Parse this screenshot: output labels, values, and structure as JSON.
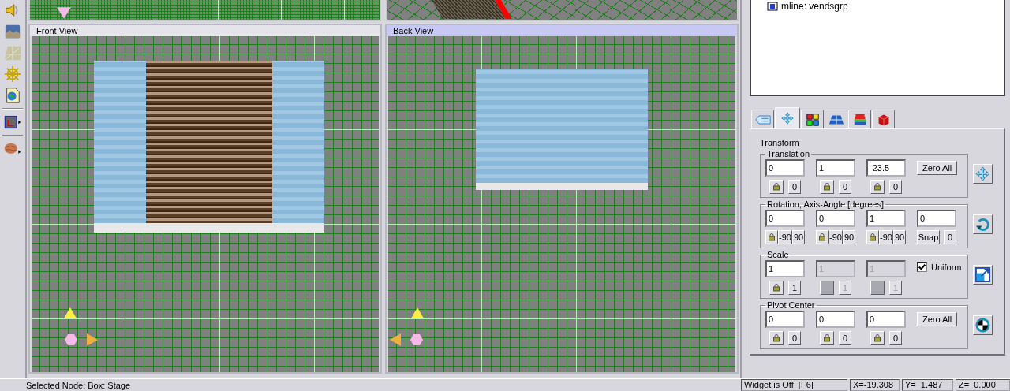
{
  "views": [
    {
      "title": "Front View",
      "selected": false
    },
    {
      "title": "Back View",
      "selected": true
    }
  ],
  "tree": {
    "items": [
      {
        "label": "mline: vendsgrp"
      }
    ]
  },
  "tabs": [
    {
      "kind": "tag",
      "selected": false
    },
    {
      "kind": "move",
      "selected": true
    },
    {
      "kind": "colors",
      "selected": false
    },
    {
      "kind": "plane",
      "selected": false
    },
    {
      "kind": "layers",
      "selected": false
    },
    {
      "kind": "cube",
      "selected": false
    }
  ],
  "transform": {
    "title": "Transform",
    "groups": [
      {
        "title": "Translation",
        "kind": "move",
        "fields": [
          {
            "value": "0",
            "disabled": false,
            "lock": true,
            "buttons": [
              "0"
            ]
          },
          {
            "value": "1",
            "disabled": false,
            "lock": true,
            "buttons": [
              "0"
            ]
          },
          {
            "value": "-23.5",
            "disabled": false,
            "lock": true,
            "buttons": [
              "0"
            ]
          }
        ],
        "extra": {
          "kind": "button",
          "label": "Zero All"
        }
      },
      {
        "title": "Rotation, Axis-Angle  [degrees]",
        "kind": "rotate",
        "fields": [
          {
            "value": "0",
            "disabled": false,
            "lock": true,
            "buttons": [
              "-90",
              "90"
            ]
          },
          {
            "value": "0",
            "disabled": false,
            "lock": true,
            "buttons": [
              "-90",
              "90"
            ]
          },
          {
            "value": "1",
            "disabled": false,
            "lock": true,
            "buttons": [
              "-90",
              "90"
            ]
          },
          {
            "value": "0",
            "disabled": false,
            "lock": false,
            "buttons": [
              "Snap",
              "0"
            ]
          }
        ]
      },
      {
        "title": "Scale",
        "kind": "scale",
        "fields": [
          {
            "value": "1",
            "disabled": false,
            "lock": true,
            "buttons": [
              "1"
            ]
          },
          {
            "value": "1",
            "disabled": true,
            "lock": true,
            "buttons": [
              "1"
            ]
          },
          {
            "value": "1",
            "disabled": true,
            "lock": true,
            "buttons": [
              "1"
            ]
          }
        ],
        "extra": {
          "kind": "checkbox",
          "label": "Uniform",
          "checked": true
        }
      },
      {
        "title": "Pivot Center",
        "kind": "pivot",
        "fields": [
          {
            "value": "0",
            "disabled": false,
            "lock": true,
            "buttons": [
              "0"
            ]
          },
          {
            "value": "0",
            "disabled": false,
            "lock": true,
            "buttons": [
              "0"
            ]
          },
          {
            "value": "0",
            "disabled": false,
            "lock": true,
            "buttons": [
              "0"
            ]
          }
        ],
        "extra": {
          "kind": "button",
          "label": "Zero All"
        }
      }
    ]
  },
  "status_bar": {
    "selected_node": "Selected Node: Box:  Stage",
    "widget": "Widget is Off  [F6]",
    "x": "X=-19.308",
    "y": "Y=  1.487",
    "z": "Z=  0.000"
  }
}
